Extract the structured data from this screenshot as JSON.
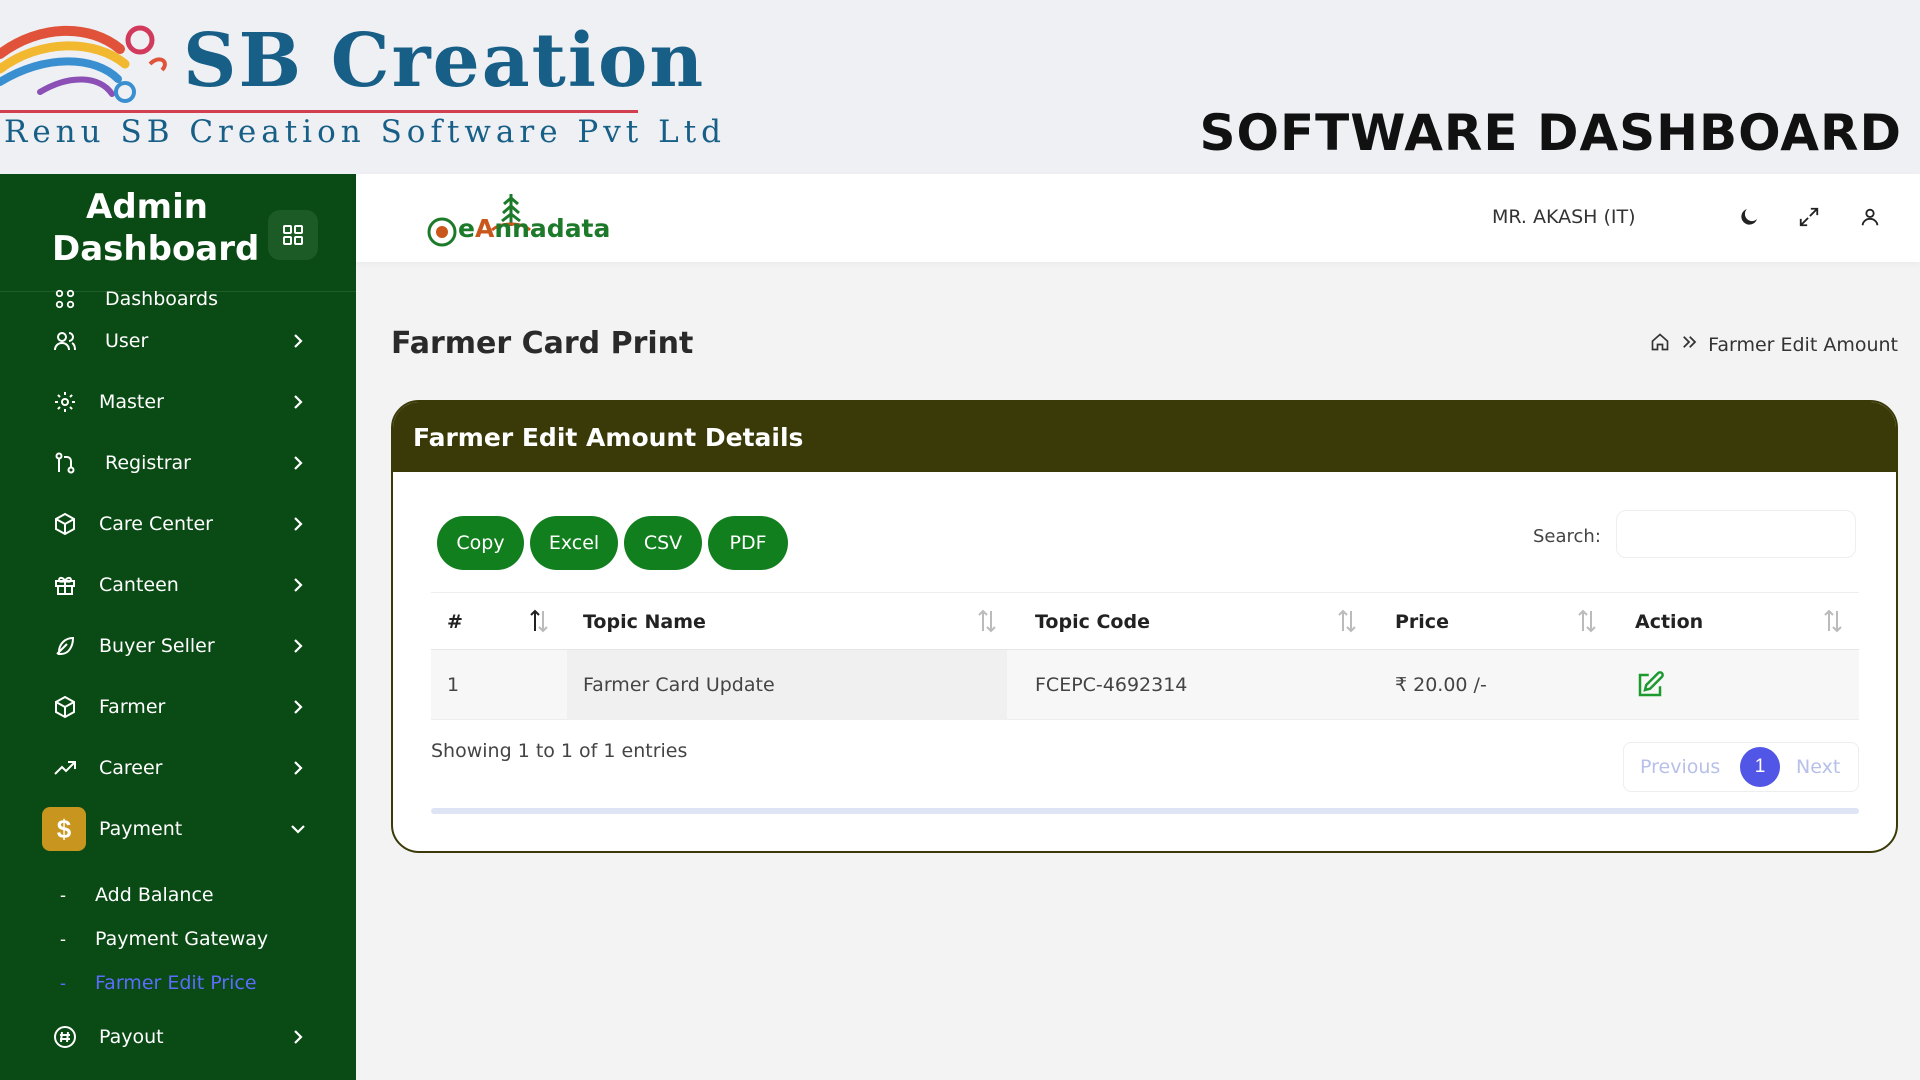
{
  "banner": {
    "company": "SB Creation",
    "tagline": "Renu SB Creation Software Pvt Ltd",
    "headline": "SOFTWARE DASHBOARD"
  },
  "sidebar": {
    "title_line1": "Admin",
    "title_line2": "Dashboard",
    "items": [
      {
        "label": "Dashboards",
        "icon": "dashboard-icon"
      },
      {
        "label": "User",
        "icon": "user-icon"
      },
      {
        "label": "Master",
        "icon": "gear-icon"
      },
      {
        "label": "Registrar",
        "icon": "git-branch-icon"
      },
      {
        "label": "Care Center",
        "icon": "box-icon"
      },
      {
        "label": "Canteen",
        "icon": "gift-icon"
      },
      {
        "label": "Buyer Seller",
        "icon": "feather-icon"
      },
      {
        "label": "Farmer",
        "icon": "box-icon"
      },
      {
        "label": "Career",
        "icon": "trending-up-icon"
      },
      {
        "label": "Payment",
        "icon": "dollar-icon",
        "icon_glyph": "$"
      },
      {
        "label": "Payout",
        "icon": "hash-circle-icon"
      }
    ],
    "payment_sub": [
      {
        "label": "Add Balance"
      },
      {
        "label": "Payment Gateway"
      },
      {
        "label": "Farmer Edit Price",
        "active": true
      }
    ],
    "dash": "-"
  },
  "topbar": {
    "logo_e": "e",
    "logo_a": "A",
    "logo_rest": "nnadata",
    "user": "MR. AKASH (IT)"
  },
  "page": {
    "title": "Farmer Card Print",
    "breadcrumb_current": "Farmer Edit Amount"
  },
  "card": {
    "title": "Farmer Edit Amount Details",
    "buttons": {
      "copy": "Copy",
      "excel": "Excel",
      "csv": "CSV",
      "pdf": "PDF"
    },
    "search_label": "Search:",
    "search_value": "",
    "columns": [
      "#",
      "Topic Name",
      "Topic Code",
      "Price",
      "Action"
    ],
    "rows": [
      {
        "num": "1",
        "topic_name": "Farmer Card Update",
        "topic_code": "FCEPC-4692314",
        "price": "₹ 20.00 /-"
      }
    ],
    "showing": "Showing 1 to 1 of 1 entries",
    "pagination": {
      "previous": "Previous",
      "page": "1",
      "next": "Next"
    }
  },
  "colors": {
    "sidebar_bg": "#0a4a14",
    "card_header": "#3a3a08",
    "button_green": "#127f1e",
    "payment_icon": "#c8951e",
    "active_link": "#5b6cff",
    "brand_blue": "#175f86"
  }
}
